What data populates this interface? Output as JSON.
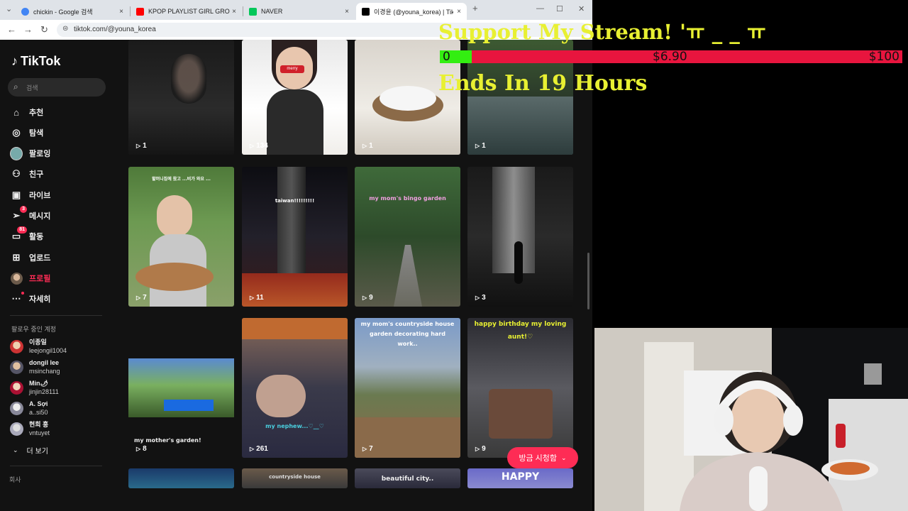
{
  "browser": {
    "tabs": [
      {
        "title": "chickin - Google 검색",
        "favicon_color": "#4285f4"
      },
      {
        "title": "KPOP PLAYLIST GIRL GROUP",
        "favicon_color": "#ff0000"
      },
      {
        "title": "NAVER",
        "favicon_color": "#03c75a"
      },
      {
        "title": "이경윤 (@youna_korea) | TikT",
        "favicon_color": "#000000"
      }
    ],
    "new_tab": "+",
    "close_glyph": "×",
    "url": "tiktok.com/@youna_korea"
  },
  "tiktok": {
    "logo_text": "TikTok",
    "search_placeholder": "검색",
    "menu": [
      {
        "label": "추천",
        "icon": "home-icon"
      },
      {
        "label": "탐색",
        "icon": "compass-icon"
      },
      {
        "label": "팔로잉",
        "icon": "following-avatar-icon"
      },
      {
        "label": "친구",
        "icon": "friends-icon"
      },
      {
        "label": "라이브",
        "icon": "live-icon"
      },
      {
        "label": "메시지",
        "icon": "message-icon",
        "badge": "3"
      },
      {
        "label": "활동",
        "icon": "activity-icon",
        "badge": "81"
      },
      {
        "label": "업로드",
        "icon": "upload-icon"
      },
      {
        "label": "프로필",
        "icon": "profile-avatar-icon"
      },
      {
        "label": "자세히",
        "icon": "more-dots-icon"
      }
    ],
    "following_title": "팔로우 중인 계정",
    "following": [
      {
        "name": "이종일",
        "handle": "leejongil1004"
      },
      {
        "name": "dongil lee",
        "handle": "msinchang"
      },
      {
        "name": "Min🌶",
        "handle": "jinjin28111"
      },
      {
        "name": "A. Sợi",
        "handle": "a..si50"
      },
      {
        "name": "현희 홍",
        "handle": "vntuyet"
      }
    ],
    "see_more": "더 보기",
    "company": "회사",
    "videos": [
      {
        "views": "1"
      },
      {
        "views": "134",
        "caption": "merry"
      },
      {
        "views": "1"
      },
      {
        "views": "1"
      },
      {
        "views": "7",
        "caption": "할머니집에 왔고 ...비가 와요 ..."
      },
      {
        "views": "11",
        "caption": "taiwan!!!!!!!!!"
      },
      {
        "views": "9",
        "caption": "my mom's bingo garden"
      },
      {
        "views": "3"
      },
      {
        "views": "8",
        "caption": "my mother's garden!"
      },
      {
        "views": "261",
        "caption": "my nephew...♡__♡"
      },
      {
        "views": "7",
        "caption": "my mom's countryside house garden decorating hard work.."
      },
      {
        "views": "9",
        "caption": "happy birthday my loving aunt!♡"
      },
      {
        "caption": ""
      },
      {
        "caption": "countryside house"
      },
      {
        "caption": "beautiful city.."
      },
      {
        "caption": "HAPPY"
      }
    ],
    "watch_button": "방금 시청함"
  },
  "stream_overlay": {
    "title": "Support My Stream! 'ㅠ _ _ ㅠ",
    "goal_start": "0",
    "goal_current": "$6.90",
    "goal_target": "$100",
    "goal_fraction": 0.069,
    "subtitle": "Ends In 19 Hours",
    "colors": {
      "text": "#e8f032",
      "bar": "#e8153e",
      "fill": "#33ee11"
    }
  }
}
